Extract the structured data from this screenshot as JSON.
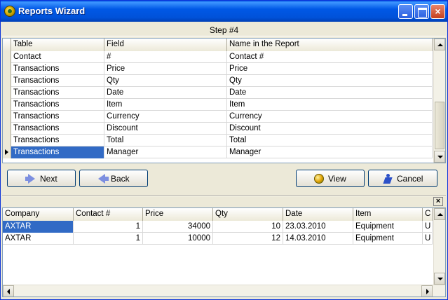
{
  "window": {
    "title": "Reports Wizard",
    "close_glyph": "×"
  },
  "step": "Step #4",
  "fields_grid": {
    "columns": [
      "Table",
      "Field",
      "Name in the Report"
    ],
    "rows": [
      [
        "Contact",
        "#",
        "Contact #"
      ],
      [
        "Transactions",
        "Price",
        "Price"
      ],
      [
        "Transactions",
        "Qty",
        "Qty"
      ],
      [
        "Transactions",
        "Date",
        "Date"
      ],
      [
        "Transactions",
        "Item",
        "Item"
      ],
      [
        "Transactions",
        "Currency",
        "Currency"
      ],
      [
        "Transactions",
        "Discount",
        "Discount"
      ],
      [
        "Transactions",
        "Total",
        "Total"
      ],
      [
        "Transactions",
        "Manager",
        "Manager"
      ]
    ],
    "current_row": 8
  },
  "buttons": {
    "next": "Next",
    "back": "Back",
    "view": "View",
    "cancel": "Cancel"
  },
  "preview": {
    "close_glyph": "×",
    "columns": [
      "Company",
      "Contact #",
      "Price",
      "Qty",
      "Date",
      "Item",
      "C"
    ],
    "rows": [
      [
        "AXTAR",
        "1",
        "34000",
        "10",
        "23.03.2010",
        "Equipment",
        "U"
      ],
      [
        "AXTAR",
        "1",
        "10000",
        "12",
        "14.03.2010",
        "Equipment",
        "U"
      ]
    ]
  },
  "colors": {
    "titlebar": "#0058e6",
    "selection": "#316ac5",
    "window_bg": "#ece9d8"
  },
  "icons": {
    "app": "wizard-app-icon",
    "next": "arrow-right-icon",
    "back": "arrow-left-icon",
    "view": "view-globe-icon",
    "cancel": "running-man-icon"
  }
}
